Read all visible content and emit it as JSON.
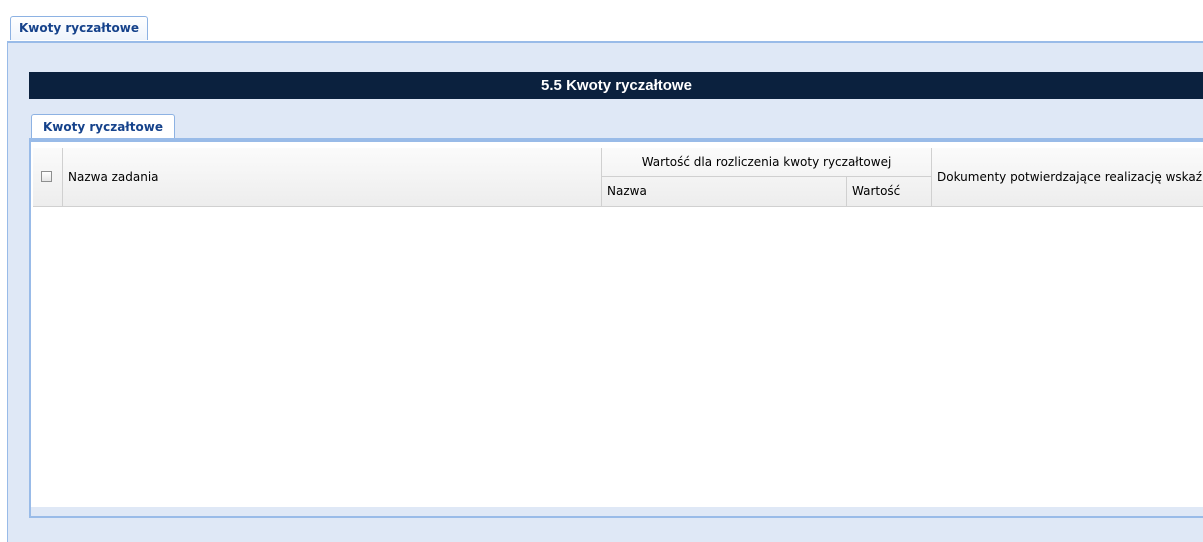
{
  "outer_tab": {
    "label": "Kwoty ryczałtowe"
  },
  "section": {
    "title": "5.5 Kwoty ryczałtowe"
  },
  "inner_tab": {
    "label": "Kwoty ryczałtowe"
  },
  "grid": {
    "columns": {
      "task_name": "Nazwa zadania",
      "settlement_group": "Wartość dla rozliczenia kwoty ryczałtowej",
      "settlement_name": "Nazwa",
      "settlement_value": "Wartość",
      "documents": "Dokumenty potwierdzające realizację wskaźnika"
    },
    "rows": []
  },
  "colors": {
    "header_bar": "#0b213e",
    "panel_background": "#dfe8f6",
    "tab_text": "#15428b",
    "border": "#99bbe8"
  }
}
